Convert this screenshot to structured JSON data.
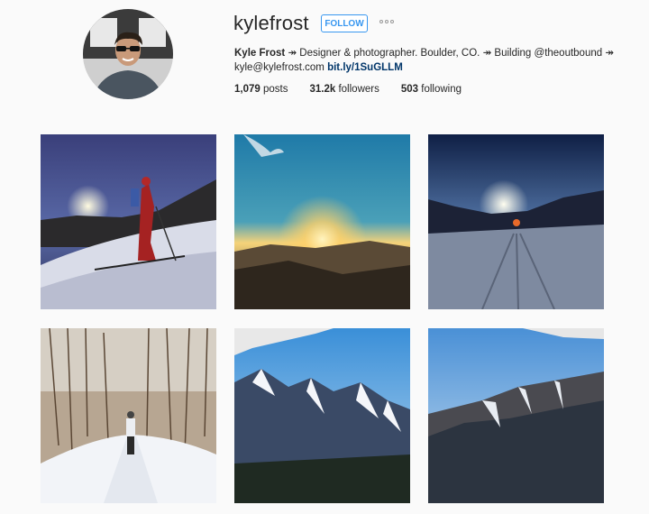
{
  "profile": {
    "username": "kylefrost",
    "follow_label": "FOLLOW",
    "more_icon": "more-options-icon",
    "bio": {
      "name": "Kyle Frost",
      "line1_rest": "↠ Designer & photographer. Boulder, CO. ↠ Building @theoutbound ↠",
      "email": "kyle@kylefrost.com",
      "link": "bit.ly/1SuGLLM"
    },
    "stats": {
      "posts_count": "1,079",
      "posts_label": "posts",
      "followers_count": "31.2k",
      "followers_label": "followers",
      "following_count": "503",
      "following_label": "following"
    }
  },
  "colors": {
    "accent": "#3897f0",
    "link": "#003569",
    "background": "#fafafa"
  }
}
